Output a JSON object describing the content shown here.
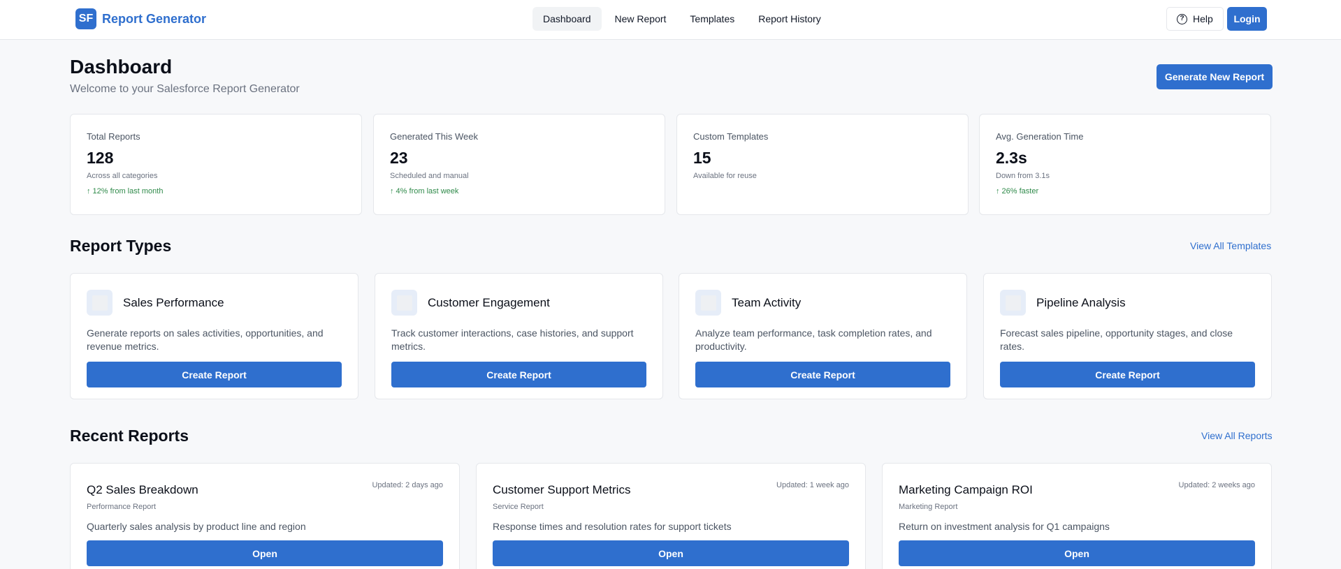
{
  "brand": {
    "logo_text": "SF",
    "name": "Report Generator"
  },
  "nav": {
    "items": [
      {
        "label": "Dashboard"
      },
      {
        "label": "New Report"
      },
      {
        "label": "Templates"
      },
      {
        "label": "Report History"
      }
    ],
    "active": "Dashboard",
    "help_label": "Help",
    "login_label": "Login"
  },
  "header": {
    "title": "Dashboard",
    "subtitle": "Welcome to your Salesforce Report Generator",
    "primary_button": "Generate New Report"
  },
  "stats": [
    {
      "label": "Total Reports",
      "value": "128",
      "desc": "Across all categories",
      "trend": "↑ 12% from last month"
    },
    {
      "label": "Generated This Week",
      "value": "23",
      "desc": "Scheduled and manual",
      "trend": "↑ 4% from last week"
    },
    {
      "label": "Custom Templates",
      "value": "15",
      "desc": "Available for reuse",
      "trend": ""
    },
    {
      "label": "Avg. Generation Time",
      "value": "2.3s",
      "desc": "Down from 3.1s",
      "trend": "↑ 26% faster"
    }
  ],
  "report_types": {
    "title": "Report Types",
    "link": "View All Templates",
    "items": [
      {
        "title": "Sales Performance",
        "desc": "Generate reports on sales activities, opportunities, and revenue metrics.",
        "button": "Create Report"
      },
      {
        "title": "Customer Engagement",
        "desc": "Track customer interactions, case histories, and support metrics.",
        "button": "Create Report"
      },
      {
        "title": "Team Activity",
        "desc": "Analyze team performance, task completion rates, and productivity.",
        "button": "Create Report"
      },
      {
        "title": "Pipeline Analysis",
        "desc": "Forecast sales pipeline, opportunity stages, and close rates.",
        "button": "Create Report"
      }
    ]
  },
  "recent_reports": {
    "title": "Recent Reports",
    "link": "View All Reports",
    "items": [
      {
        "title": "Q2 Sales Breakdown",
        "updated": "Updated: 2 days ago",
        "type": "Performance Report",
        "desc": "Quarterly sales analysis by product line and region",
        "button": "Open"
      },
      {
        "title": "Customer Support Metrics",
        "updated": "Updated: 1 week ago",
        "type": "Service Report",
        "desc": "Response times and resolution rates for support tickets",
        "button": "Open"
      },
      {
        "title": "Marketing Campaign ROI",
        "updated": "Updated: 2 weeks ago",
        "type": "Marketing Report",
        "desc": "Return on investment analysis for Q1 campaigns",
        "button": "Open"
      }
    ]
  },
  "colors": {
    "accent": "#2f6fce",
    "trend_positive": "#2f8a4a",
    "background": "#f7f8fa"
  }
}
